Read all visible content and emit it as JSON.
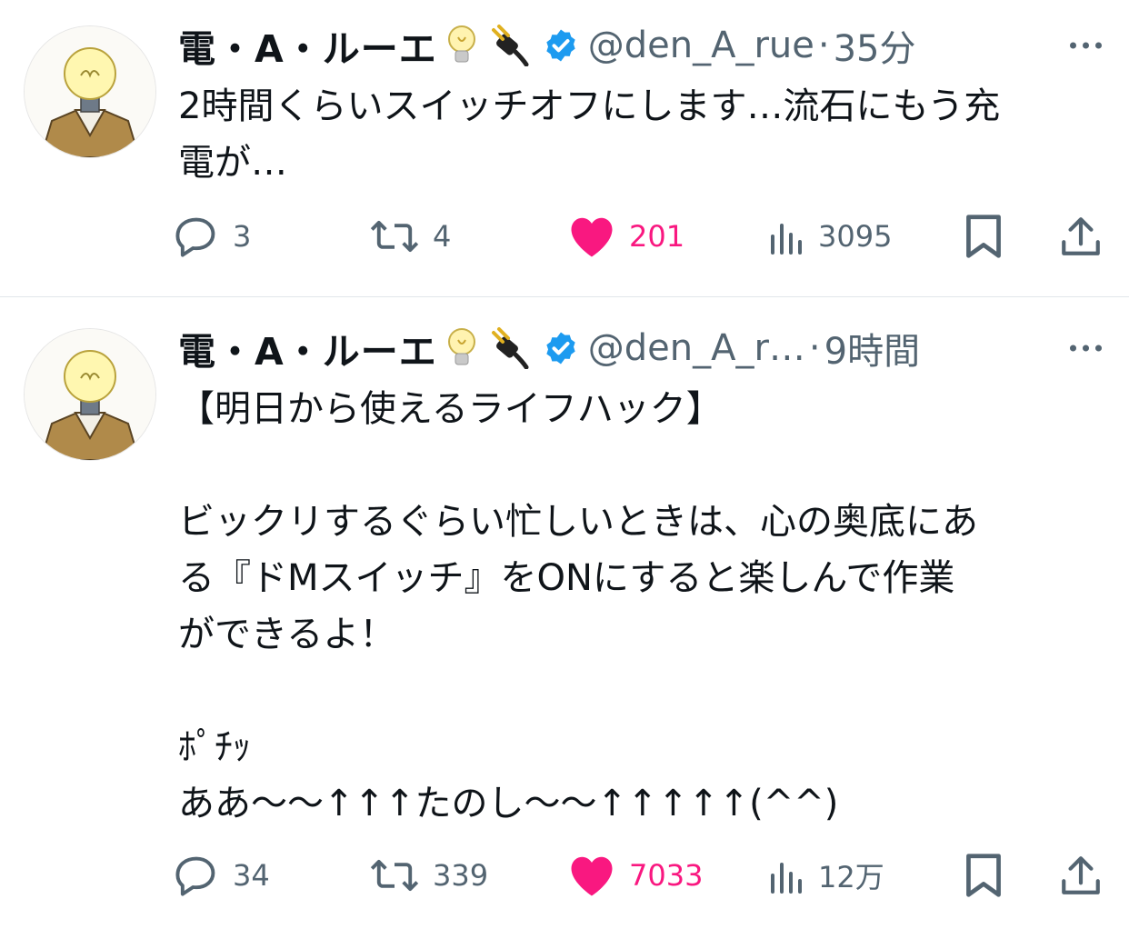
{
  "colors": {
    "text": "#0f1419",
    "muted": "#536471",
    "like": "#f91880",
    "verified": "#1d9bf0",
    "divider": "#e1e6ea"
  },
  "tweets": [
    {
      "author": {
        "name": "電・A・ルーエ",
        "emoji": [
          "💡",
          "🔌"
        ],
        "verified": true,
        "handle": "@den_A_rue"
      },
      "separator": "·",
      "time": "35分",
      "text": "2時間くらいスイッチオフにします…流石にもう充\n電が…",
      "stats": {
        "replies": "3",
        "retweets": "4",
        "likes": "201",
        "liked": true,
        "views": "3095"
      },
      "icons": [
        "reply-icon",
        "retweet-icon",
        "like-icon",
        "views-icon",
        "bookmark-icon",
        "share-icon",
        "more-icon"
      ]
    },
    {
      "author": {
        "name": "電・A・ルーエ",
        "emoji": [
          "💡",
          "🔌"
        ],
        "verified": true,
        "handle": "@den_A_r…"
      },
      "separator": "·",
      "time": "9時間",
      "text": "【明日から使えるライフハック】\n\nビックリするぐらい忙しいときは、心の奥底にあ\nる『ドMスイッチ』をONにすると楽しんで作業\nができるよ！\n\nﾎﾟﾁｯ\nああ〜〜↑↑↑たのし〜〜↑↑↑↑↑(^^)",
      "stats": {
        "replies": "34",
        "retweets": "339",
        "likes": "7033",
        "liked": true,
        "views": "12万"
      },
      "icons": [
        "reply-icon",
        "retweet-icon",
        "like-icon",
        "views-icon",
        "bookmark-icon",
        "share-icon",
        "more-icon"
      ]
    }
  ]
}
